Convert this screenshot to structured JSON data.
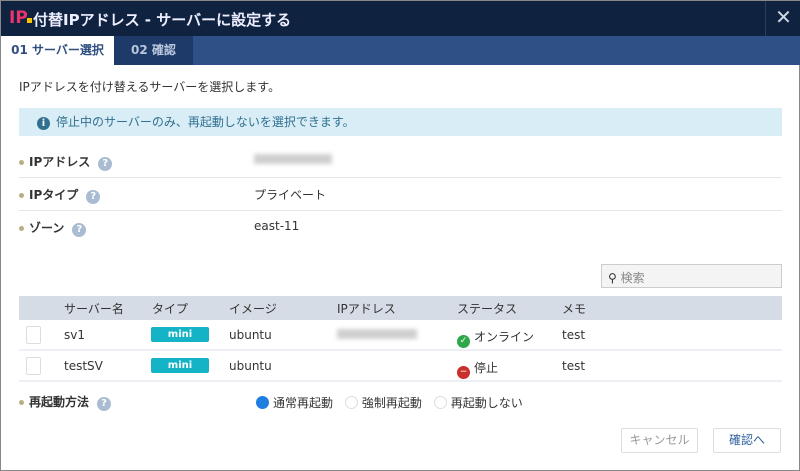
{
  "dialog": {
    "logo": "IP",
    "title": "付替IPアドレス - サーバーに設定する",
    "close_icon": "close-icon"
  },
  "tabs": [
    {
      "label": "01 サーバー選択",
      "active": true
    },
    {
      "label": "02 確認",
      "active": false
    }
  ],
  "description": "IPアドレスを付け替えるサーバーを選択します。",
  "info": "停止中のサーバーのみ、再起動しないを選択できます。",
  "fields": [
    {
      "label": "IPアドレス",
      "value": ""
    },
    {
      "label": "IPタイプ",
      "value": "プライベート"
    },
    {
      "label": "ゾーン",
      "value": "east-11"
    }
  ],
  "search": {
    "placeholder": "検索"
  },
  "table": {
    "headers": [
      "サーバー名",
      "タイプ",
      "イメージ",
      "IPアドレス",
      "ステータス",
      "メモ"
    ],
    "rows": [
      {
        "name": "sv1",
        "type": "mini",
        "image": "ubuntu",
        "ip": "",
        "status": "オンライン",
        "status_kind": "online",
        "memo": "test"
      },
      {
        "name": "testSV",
        "type": "mini",
        "image": "ubuntu",
        "ip": "",
        "status": "停止",
        "status_kind": "stopped",
        "memo": "test"
      }
    ]
  },
  "restart": {
    "label": "再起動方法",
    "options": [
      "通常再起動",
      "強制再起動",
      "再起動しない"
    ],
    "selected": 0
  },
  "buttons": {
    "cancel": "キャンセル",
    "confirm": "確認へ"
  },
  "colors": {
    "titlebar": "#0f2340",
    "accent": "#14b4c6",
    "online": "#2ea84a",
    "stopped": "#c9302c"
  }
}
